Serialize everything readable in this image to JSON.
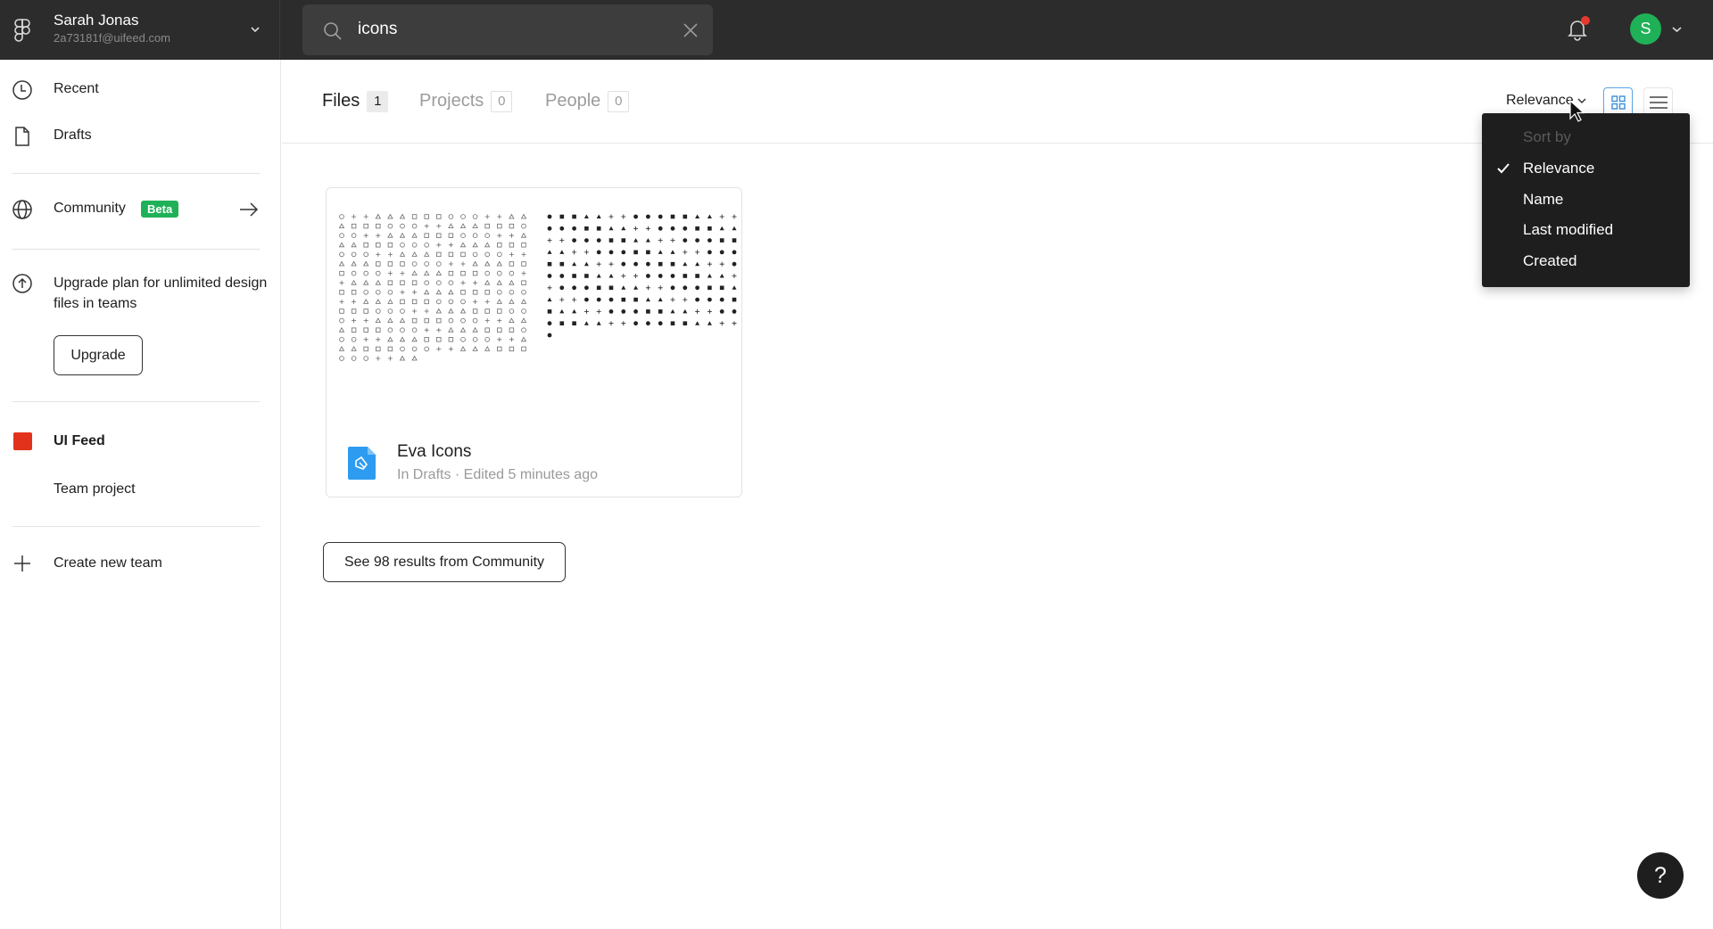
{
  "account": {
    "name": "Sarah Jonas",
    "email": "2a73181f@uifeed.com",
    "avatar_initial": "S"
  },
  "search": {
    "value": "icons",
    "placeholder": "Search"
  },
  "notifications": {
    "has_unread": true
  },
  "sidebar": {
    "items": [
      {
        "label": "Recent",
        "icon": "clock-icon"
      },
      {
        "label": "Drafts",
        "icon": "file-icon"
      },
      {
        "label": "Community",
        "icon": "globe-icon",
        "badge": "Beta"
      }
    ],
    "upgrade": {
      "text": "Upgrade plan for unlimited design files in teams",
      "button_label": "Upgrade"
    },
    "team": {
      "name": "UI Feed",
      "color": "#e3321b",
      "projects": [
        "Team project"
      ]
    },
    "create_team_label": "Create new team"
  },
  "results": {
    "tabs": [
      {
        "label": "Files",
        "count": "1",
        "active": true
      },
      {
        "label": "Projects",
        "count": "0",
        "active": false
      },
      {
        "label": "People",
        "count": "0",
        "active": false
      }
    ],
    "sort": {
      "selected": "Relevance",
      "menu_header": "Sort by",
      "options": [
        "Relevance",
        "Name",
        "Last modified",
        "Created"
      ]
    },
    "view_mode": "grid",
    "files": [
      {
        "title": "Eva Icons",
        "location": "In Drafts",
        "edited": "Edited 5 minutes ago",
        "meta": "In Drafts · Edited 5 minutes ago"
      }
    ],
    "community_button_label": "See 98 results from Community"
  },
  "help_label": "?",
  "colors": {
    "topbar": "#2c2c2c",
    "accent_green": "#1fb157",
    "notification_red": "#e5392f",
    "grid_selected": "#5aa5e6",
    "file_icon_blue": "#2d9cf0"
  }
}
